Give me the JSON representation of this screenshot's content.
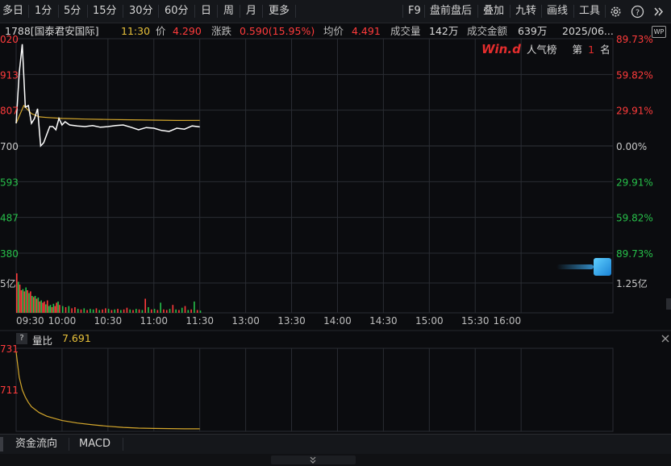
{
  "toolbar": {
    "periods": [
      "多日",
      "1分",
      "5分",
      "15分",
      "30分",
      "60分",
      "日",
      "周",
      "月",
      "更多"
    ],
    "right": [
      "F9",
      "盘前盘后",
      "叠加",
      "九转",
      "画线",
      "工具"
    ],
    "gear_icon": "gear-icon",
    "help_icon": "help-icon",
    "expand_icon": "double-chevron-right-icon"
  },
  "info": {
    "code_name": "1788[国泰君安国际]",
    "time": "11:30",
    "price_label": "价",
    "price": "4.290",
    "change_label": "涨跌",
    "change": "0.590(15.95%)",
    "avg_label": "均价",
    "avg": "4.491",
    "volume_label": "成交量",
    "volume": "142万",
    "amount_label": "成交金额",
    "amount": "639万",
    "date": "2025/06..."
  },
  "badge": {
    "logo": "Win.d",
    "label": "人气榜",
    "rank_prefix": "第",
    "rank": "1",
    "rank_suffix": "名",
    "wp_label": "WP"
  },
  "colors": {
    "up": "#ff3b3b",
    "down": "#27c04a",
    "price_line": "#ffffff",
    "avg_line": "#d4a72c",
    "grid": "#2a2d33"
  },
  "chart_data": [
    {
      "type": "line",
      "name": "intraday",
      "left_axis_labels": [
        "020",
        "913",
        "807",
        "700",
        "593",
        "487",
        "380"
      ],
      "right_axis_labels": [
        "89.73%",
        "59.82%",
        "29.91%",
        "0.00%",
        "29.91%",
        "59.82%",
        "89.73%"
      ],
      "xticks": [
        "09:30",
        "10:00",
        "10:30",
        "11:00",
        "11:30",
        "13:00",
        "13:30",
        "14:00",
        "14:30",
        "15:00",
        "15:30",
        "16:00"
      ],
      "prev_close": 3.7,
      "ylim": [
        0.38,
        7.02
      ],
      "price_series_minutes": [
        0,
        2,
        4,
        6,
        8,
        10,
        12,
        14,
        16,
        18,
        20,
        22,
        24,
        26,
        28,
        30,
        32,
        35,
        40,
        45,
        50,
        55,
        60,
        65,
        70,
        75,
        80,
        85,
        90,
        95,
        100,
        105,
        110,
        115,
        120
      ],
      "price_series": [
        4.4,
        5.95,
        6.85,
        4.9,
        4.95,
        4.4,
        4.55,
        4.85,
        3.7,
        3.8,
        4.05,
        4.3,
        4.3,
        4.2,
        4.55,
        4.35,
        4.45,
        4.35,
        4.32,
        4.3,
        4.33,
        4.28,
        4.3,
        4.33,
        4.35,
        4.28,
        4.2,
        4.27,
        4.25,
        4.18,
        4.15,
        4.25,
        4.22,
        4.32,
        4.29
      ],
      "avg_series_minutes": [
        0,
        5,
        10,
        15,
        20,
        30,
        45,
        60,
        75,
        90,
        105,
        120
      ],
      "avg_series": [
        4.4,
        4.95,
        4.7,
        4.6,
        4.58,
        4.55,
        4.53,
        4.52,
        4.51,
        4.5,
        4.49,
        4.491
      ]
    },
    {
      "type": "bar",
      "name": "volume",
      "right_axis_label": "1.25亿",
      "left_axis_label": "5亿",
      "minutes": [
        0,
        1,
        2,
        3,
        4,
        5,
        6,
        7,
        8,
        9,
        10,
        11,
        12,
        13,
        14,
        15,
        16,
        17,
        18,
        19,
        20,
        21,
        22,
        23,
        24,
        25,
        26,
        27,
        28,
        30,
        32,
        34,
        36,
        38,
        40,
        42,
        44,
        46,
        48,
        50,
        52,
        54,
        56,
        58,
        60,
        62,
        64,
        66,
        68,
        70,
        72,
        74,
        76,
        78,
        80,
        82,
        84,
        86,
        88,
        90,
        92,
        94,
        96,
        98,
        100,
        102,
        104,
        106,
        108,
        110,
        112,
        114,
        116,
        118,
        120
      ],
      "values": [
        0.7,
        0.55,
        0.5,
        0.4,
        0.42,
        0.38,
        0.45,
        0.4,
        0.35,
        0.38,
        0.3,
        0.28,
        0.3,
        0.25,
        0.27,
        0.2,
        0.22,
        0.18,
        0.2,
        0.15,
        0.22,
        0.12,
        0.14,
        0.1,
        0.16,
        0.12,
        0.18,
        0.2,
        0.14,
        0.12,
        0.1,
        0.12,
        0.08,
        0.1,
        0.07,
        0.06,
        0.08,
        0.05,
        0.07,
        0.06,
        0.08,
        0.05,
        0.06,
        0.08,
        0.07,
        0.05,
        0.06,
        0.07,
        0.05,
        0.06,
        0.09,
        0.06,
        0.05,
        0.07,
        0.06,
        0.05,
        0.25,
        0.1,
        0.06,
        0.07,
        0.05,
        0.18,
        0.06,
        0.05,
        0.07,
        0.14,
        0.06,
        0.05,
        0.09,
        0.12,
        0.05,
        0.06,
        0.2,
        0.05,
        0.04
      ],
      "up": [
        1,
        0,
        1,
        1,
        0,
        1,
        0,
        1,
        0,
        1,
        0,
        1,
        0,
        1,
        0,
        1,
        0,
        1,
        1,
        0,
        1,
        0,
        0,
        1,
        0,
        1,
        1,
        0,
        1,
        0,
        1,
        0,
        1,
        1,
        0,
        1,
        0,
        1,
        0,
        0,
        1,
        0,
        1,
        1,
        0,
        1,
        0,
        1,
        0,
        1,
        1,
        0,
        1,
        0,
        1,
        0,
        1,
        0,
        1,
        0,
        1,
        0,
        1,
        1,
        0,
        1,
        0,
        1,
        0,
        1,
        0,
        1,
        0,
        1,
        0
      ],
      "ylim": [
        0,
        1.0
      ]
    },
    {
      "type": "line",
      "name": "volume-ratio",
      "label": "量比",
      "value": "7.691",
      "left_axis_labels": [
        "731",
        "711"
      ],
      "minutes": [
        0,
        2,
        4,
        6,
        8,
        10,
        15,
        20,
        25,
        30,
        40,
        50,
        60,
        70,
        80,
        90,
        100,
        110,
        120
      ],
      "values": [
        29.0,
        22.0,
        18.5,
        16.5,
        15.0,
        13.8,
        12.2,
        11.2,
        10.6,
        10.0,
        9.3,
        8.8,
        8.4,
        8.1,
        7.9,
        7.8,
        7.75,
        7.7,
        7.691
      ],
      "ylim": [
        7.0,
        30.0
      ]
    }
  ],
  "bottom_tabs": [
    "资金流向",
    "MACD"
  ]
}
